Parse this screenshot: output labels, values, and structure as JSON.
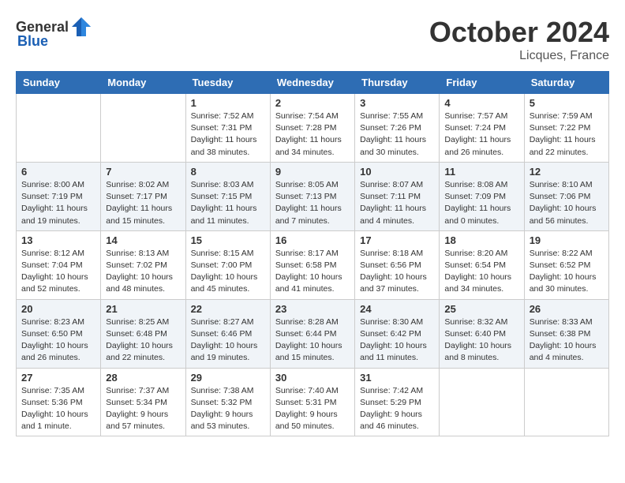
{
  "header": {
    "logo_general": "General",
    "logo_blue": "Blue",
    "month": "October 2024",
    "location": "Licques, France"
  },
  "days_of_week": [
    "Sunday",
    "Monday",
    "Tuesday",
    "Wednesday",
    "Thursday",
    "Friday",
    "Saturday"
  ],
  "weeks": [
    [
      {
        "day": "",
        "info": ""
      },
      {
        "day": "",
        "info": ""
      },
      {
        "day": "1",
        "info": "Sunrise: 7:52 AM\nSunset: 7:31 PM\nDaylight: 11 hours and 38 minutes."
      },
      {
        "day": "2",
        "info": "Sunrise: 7:54 AM\nSunset: 7:28 PM\nDaylight: 11 hours and 34 minutes."
      },
      {
        "day": "3",
        "info": "Sunrise: 7:55 AM\nSunset: 7:26 PM\nDaylight: 11 hours and 30 minutes."
      },
      {
        "day": "4",
        "info": "Sunrise: 7:57 AM\nSunset: 7:24 PM\nDaylight: 11 hours and 26 minutes."
      },
      {
        "day": "5",
        "info": "Sunrise: 7:59 AM\nSunset: 7:22 PM\nDaylight: 11 hours and 22 minutes."
      }
    ],
    [
      {
        "day": "6",
        "info": "Sunrise: 8:00 AM\nSunset: 7:19 PM\nDaylight: 11 hours and 19 minutes."
      },
      {
        "day": "7",
        "info": "Sunrise: 8:02 AM\nSunset: 7:17 PM\nDaylight: 11 hours and 15 minutes."
      },
      {
        "day": "8",
        "info": "Sunrise: 8:03 AM\nSunset: 7:15 PM\nDaylight: 11 hours and 11 minutes."
      },
      {
        "day": "9",
        "info": "Sunrise: 8:05 AM\nSunset: 7:13 PM\nDaylight: 11 hours and 7 minutes."
      },
      {
        "day": "10",
        "info": "Sunrise: 8:07 AM\nSunset: 7:11 PM\nDaylight: 11 hours and 4 minutes."
      },
      {
        "day": "11",
        "info": "Sunrise: 8:08 AM\nSunset: 7:09 PM\nDaylight: 11 hours and 0 minutes."
      },
      {
        "day": "12",
        "info": "Sunrise: 8:10 AM\nSunset: 7:06 PM\nDaylight: 10 hours and 56 minutes."
      }
    ],
    [
      {
        "day": "13",
        "info": "Sunrise: 8:12 AM\nSunset: 7:04 PM\nDaylight: 10 hours and 52 minutes."
      },
      {
        "day": "14",
        "info": "Sunrise: 8:13 AM\nSunset: 7:02 PM\nDaylight: 10 hours and 48 minutes."
      },
      {
        "day": "15",
        "info": "Sunrise: 8:15 AM\nSunset: 7:00 PM\nDaylight: 10 hours and 45 minutes."
      },
      {
        "day": "16",
        "info": "Sunrise: 8:17 AM\nSunset: 6:58 PM\nDaylight: 10 hours and 41 minutes."
      },
      {
        "day": "17",
        "info": "Sunrise: 8:18 AM\nSunset: 6:56 PM\nDaylight: 10 hours and 37 minutes."
      },
      {
        "day": "18",
        "info": "Sunrise: 8:20 AM\nSunset: 6:54 PM\nDaylight: 10 hours and 34 minutes."
      },
      {
        "day": "19",
        "info": "Sunrise: 8:22 AM\nSunset: 6:52 PM\nDaylight: 10 hours and 30 minutes."
      }
    ],
    [
      {
        "day": "20",
        "info": "Sunrise: 8:23 AM\nSunset: 6:50 PM\nDaylight: 10 hours and 26 minutes."
      },
      {
        "day": "21",
        "info": "Sunrise: 8:25 AM\nSunset: 6:48 PM\nDaylight: 10 hours and 22 minutes."
      },
      {
        "day": "22",
        "info": "Sunrise: 8:27 AM\nSunset: 6:46 PM\nDaylight: 10 hours and 19 minutes."
      },
      {
        "day": "23",
        "info": "Sunrise: 8:28 AM\nSunset: 6:44 PM\nDaylight: 10 hours and 15 minutes."
      },
      {
        "day": "24",
        "info": "Sunrise: 8:30 AM\nSunset: 6:42 PM\nDaylight: 10 hours and 11 minutes."
      },
      {
        "day": "25",
        "info": "Sunrise: 8:32 AM\nSunset: 6:40 PM\nDaylight: 10 hours and 8 minutes."
      },
      {
        "day": "26",
        "info": "Sunrise: 8:33 AM\nSunset: 6:38 PM\nDaylight: 10 hours and 4 minutes."
      }
    ],
    [
      {
        "day": "27",
        "info": "Sunrise: 7:35 AM\nSunset: 5:36 PM\nDaylight: 10 hours and 1 minute."
      },
      {
        "day": "28",
        "info": "Sunrise: 7:37 AM\nSunset: 5:34 PM\nDaylight: 9 hours and 57 minutes."
      },
      {
        "day": "29",
        "info": "Sunrise: 7:38 AM\nSunset: 5:32 PM\nDaylight: 9 hours and 53 minutes."
      },
      {
        "day": "30",
        "info": "Sunrise: 7:40 AM\nSunset: 5:31 PM\nDaylight: 9 hours and 50 minutes."
      },
      {
        "day": "31",
        "info": "Sunrise: 7:42 AM\nSunset: 5:29 PM\nDaylight: 9 hours and 46 minutes."
      },
      {
        "day": "",
        "info": ""
      },
      {
        "day": "",
        "info": ""
      }
    ]
  ]
}
